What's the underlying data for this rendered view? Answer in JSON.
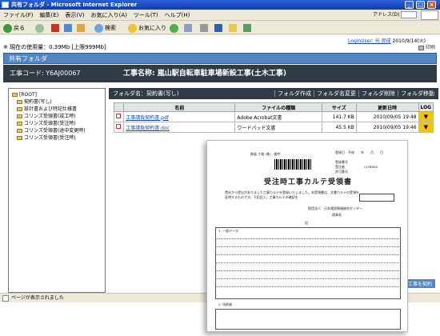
{
  "window": {
    "title": "共有フォルダ - Microsoft Internet Explorer"
  },
  "menu": [
    "ファイル(F)",
    "編集(E)",
    "表示(V)",
    "お気に入り(A)",
    "ツール(T)",
    "ヘルプ(H)"
  ],
  "addressbar": {
    "label": "アドレス(D)"
  },
  "toolbar": {
    "back": "戻る",
    "search": "検索",
    "favorites": "お気に入り"
  },
  "app": {
    "usage": "※ 現在の使用量：0.39Mb [上限999Mb]",
    "login": "LoginUser: 光 良成",
    "date": "2010/9/14(火)",
    "print": "印刷",
    "header": "共有フォルダ",
    "job_code": "工事コード: Y6AJ00067",
    "job_name": "工事名称: 嵐山駅自転車駐車場新設工事(土木工事)"
  },
  "tree": {
    "root": "[ROOT]",
    "items": [
      "契約書(写し)",
      "設計書および特記仕様書",
      "コリンズ受領書(竣工時)",
      "コリンズ受領書(受注時)",
      "コリンズ受領書(途中変更時)",
      "コリンズ受領書(受注時)"
    ]
  },
  "folder": {
    "name": "フォルダ名：契約書(写し)",
    "actions": [
      "フォルダ作成",
      "フォルダ名変更",
      "フォルダ削除",
      "フォルダ移動"
    ]
  },
  "files": {
    "columns": [
      "名前",
      "ファイルの種類",
      "サイズ",
      "更新日時",
      "LOG"
    ],
    "rows": [
      {
        "name": "工事請負契約書.pdf",
        "type": "Adobe Acrobat文書",
        "size": "141.7 KB",
        "date": "2010/09/05 19:48",
        "log": "▼"
      },
      {
        "name": "工事請負契約書.doc",
        "type": "ワードパッド文書",
        "size": "45.5 KB",
        "date": "2010/09/05 19:46",
        "log": "▼"
      }
    ]
  },
  "caption": "の工事を契約",
  "statusbar": {
    "text": "ページが表示されました"
  },
  "doc": {
    "recipient": "株島 工務 (株)　御中",
    "date_label": "登録日　平成　　年　　月　　日",
    "reg_labels": [
      "登録番号",
      "受注者",
      "CORINS",
      "許可番号"
    ],
    "title": "受注時工事カルテ受領書",
    "body1": "貴社から提出がありました工事カルテを登録いたしました。本受領書は、文書カルテの受領を",
    "body2": "証明するものです。下記記入、工事カルテの確認を",
    "org": "財団法人　日本建設情報総合センター",
    "org2": "理事長",
    "section": "記",
    "sec1": "1. 一般データ",
    "sec2": "2. 技術者"
  }
}
